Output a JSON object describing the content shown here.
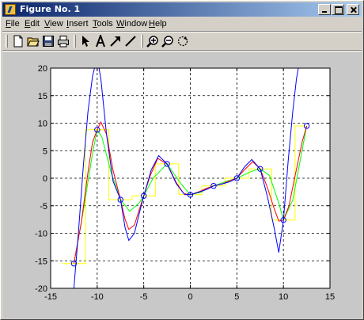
{
  "window": {
    "title": "Figure No. 1"
  },
  "menu": [
    {
      "label": "File"
    },
    {
      "label": "Edit"
    },
    {
      "label": "View"
    },
    {
      "label": "Insert"
    },
    {
      "label": "Tools"
    },
    {
      "label": "Window"
    },
    {
      "label": "Help"
    }
  ],
  "toolbar": {
    "tools": [
      "new-file-icon",
      "open-folder-icon",
      "save-icon",
      "print-icon",
      "select-arrow-icon",
      "text-icon",
      "arrow-tool-icon",
      "line-tool-icon",
      "zoom-in-icon",
      "zoom-out-icon",
      "rotate-icon"
    ]
  },
  "colors": {
    "titlebar_start": "#0a246a",
    "titlebar_end": "#a6caf0",
    "window_bg": "#d4d0c8",
    "figure_bg": "#c8c8c8",
    "axes_bg": "#ffffff"
  },
  "chart_data": {
    "type": "line",
    "title": "",
    "xlabel": "",
    "ylabel": "",
    "xlim": [
      -15,
      15
    ],
    "ylim": [
      -20,
      20
    ],
    "xticks": [
      -15,
      -10,
      -5,
      0,
      5,
      10,
      15
    ],
    "yticks": [
      -20,
      -15,
      -10,
      -5,
      0,
      5,
      10,
      15,
      20
    ],
    "grid": "dashed",
    "markers": {
      "x": [
        -12.5,
        -10,
        -7.5,
        -5,
        -2.5,
        0,
        2.5,
        5,
        7.5,
        10,
        12.5
      ],
      "y": [
        -15.5,
        8.8,
        -3.9,
        -3.2,
        2.6,
        -3.0,
        -1.4,
        0.0,
        1.7,
        -7.6,
        9.5
      ],
      "style": "circle",
      "color": "#0000ff"
    },
    "series": [
      {
        "color": "#ffff00",
        "x": [
          -13.75,
          -11.25,
          -11.25,
          -8.75,
          -8.75,
          -6.25,
          -6.25,
          -3.75,
          -3.75,
          -1.25,
          -1.25,
          1.25,
          1.25,
          3.75,
          3.75,
          6.25,
          6.25,
          8.75,
          8.75,
          11.25,
          11.25,
          12.5
        ],
        "y": [
          -15.5,
          -15.5,
          8.8,
          8.8,
          -3.9,
          -3.9,
          -3.2,
          -3.2,
          2.6,
          2.6,
          -3.0,
          -3.0,
          -1.4,
          -1.4,
          0.0,
          0.0,
          1.7,
          1.7,
          -7.6,
          -7.6,
          9.5,
          9.5
        ]
      },
      {
        "color": "#00ff00",
        "x": [
          -12.5,
          -11.5,
          -10.5,
          -10,
          -9.5,
          -8.5,
          -7.5,
          -6.5,
          -5.5,
          -5,
          -4,
          -2.5,
          -1,
          0,
          1,
          2.5,
          4,
          5,
          6.5,
          7.5,
          8.5,
          9.5,
          10,
          11,
          12.5
        ],
        "y": [
          -15.5,
          -6.0,
          4.5,
          8.8,
          7.5,
          1.0,
          -3.9,
          -6.0,
          -4.5,
          -3.2,
          0.0,
          2.6,
          -1.0,
          -3.0,
          -2.6,
          -1.4,
          -0.5,
          0.0,
          1.2,
          1.7,
          0.5,
          -4.5,
          -7.6,
          -4.0,
          9.5
        ]
      },
      {
        "color": "#ff0000",
        "x": [
          -12.5,
          -11.7,
          -11,
          -10.5,
          -10,
          -9.6,
          -9,
          -8.3,
          -7.5,
          -7,
          -6.6,
          -6,
          -5.5,
          -5,
          -4.3,
          -3.5,
          -2.5,
          -1.5,
          -0.7,
          0,
          1,
          1.8,
          2.5,
          3.5,
          4.3,
          5,
          5.8,
          6.7,
          7.5,
          8.3,
          9,
          9.5,
          10,
          10.6,
          11.2,
          12,
          12.5
        ],
        "y": [
          -15.5,
          -8.0,
          1.0,
          6.5,
          8.8,
          10.2,
          8.0,
          1.5,
          -3.9,
          -7.5,
          -9.3,
          -8.5,
          -5.8,
          -3.2,
          0.5,
          3.6,
          2.6,
          -0.8,
          -2.8,
          -3.0,
          -2.4,
          -1.8,
          -1.4,
          -1.0,
          -0.4,
          0.0,
          1.5,
          3.0,
          1.7,
          -1.8,
          -5.5,
          -7.8,
          -7.6,
          -5.0,
          0.0,
          6.5,
          9.5
        ]
      },
      {
        "color": "#0000ff",
        "x": [
          -12.5,
          -12,
          -11.5,
          -11,
          -10.5,
          -10,
          -9.6,
          -9,
          -8.3,
          -7.5,
          -7,
          -6.6,
          -6,
          -5.5,
          -5,
          -4.2,
          -3.4,
          -2.5,
          -1.5,
          -0.6,
          0,
          1,
          1.8,
          2.5,
          3.5,
          4.3,
          5,
          5.8,
          6.6,
          7.5,
          8.3,
          9,
          9.5,
          10,
          10.5,
          11,
          11.4,
          11.8
        ],
        "y": [
          -20.0,
          -9.5,
          2.0,
          12.0,
          18.5,
          22.0,
          18.0,
          8.0,
          -0.5,
          -3.9,
          -9.0,
          -11.3,
          -10.0,
          -6.5,
          -3.2,
          1.5,
          4.1,
          2.6,
          -1.0,
          -3.0,
          -3.0,
          -2.5,
          -2.0,
          -1.4,
          -1.0,
          -0.6,
          0.0,
          2.0,
          3.4,
          1.7,
          -3.5,
          -9.0,
          -13.5,
          -7.6,
          3.0,
          12.0,
          18.0,
          22.0
        ]
      }
    ]
  }
}
